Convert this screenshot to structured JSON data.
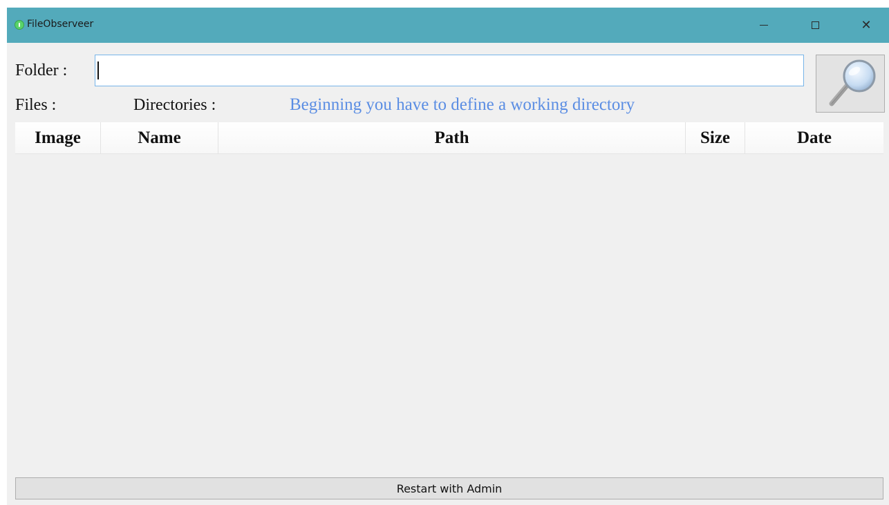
{
  "window": {
    "title": "FileObserveer",
    "app_icon": "info-circle-icon",
    "controls": {
      "minimize": "minimize-icon",
      "maximize": "maximize-icon",
      "close": "close-icon"
    }
  },
  "folder": {
    "label": "Folder :",
    "value": "",
    "search_icon": "magnifier-icon"
  },
  "stats": {
    "files_label": "Files :",
    "directories_label": "Directories :",
    "hint": "Beginning you have to define a working directory",
    "hint_color": "#5a8de3"
  },
  "table": {
    "columns": [
      "Image",
      "Name",
      "Path",
      "Size",
      "Date"
    ],
    "rows": []
  },
  "footer": {
    "restart_label": "Restart with Admin"
  },
  "colors": {
    "titlebar": "#53aabb",
    "background": "#f0f0f0"
  }
}
